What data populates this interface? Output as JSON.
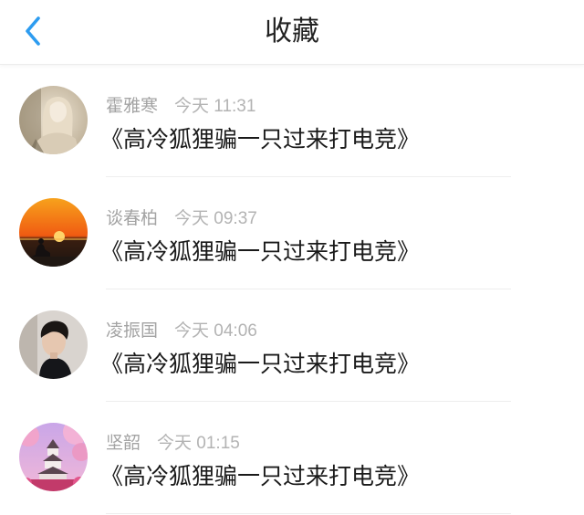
{
  "header": {
    "title": "收藏",
    "back_icon": "chevron-left-icon",
    "accent_color": "#2d9cf0"
  },
  "favorites": [
    {
      "name": "霍雅寒",
      "time": "今天 11:31",
      "content": "《高冷狐狸骗一只过来打电竞》",
      "avatar": "avatar-woman-photo"
    },
    {
      "name": "谈春柏",
      "time": "今天 09:37",
      "content": "《高冷狐狸骗一只过来打电竞》",
      "avatar": "avatar-sunset-meditation"
    },
    {
      "name": "凌振国",
      "time": "今天 04:06",
      "content": "《高冷狐狸骗一只过来打电竞》",
      "avatar": "avatar-young-man-photo"
    },
    {
      "name": "坚韶",
      "time": "今天 01:15",
      "content": "《高冷狐狸骗一只过来打电竞》",
      "avatar": "avatar-pagoda-blossom"
    }
  ]
}
